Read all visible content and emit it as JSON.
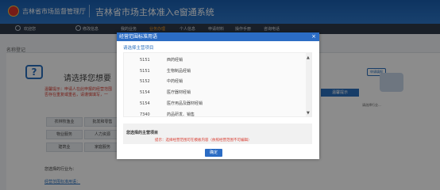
{
  "header": {
    "org": "吉林省市场监督管理厅",
    "system_title": "吉林省市场主体准入e窗通系统"
  },
  "nav": {
    "welcome": "欢迎您",
    "items": [
      {
        "label": "修改信息"
      },
      {
        "label": "我的业务"
      },
      {
        "label": "业务办理"
      },
      {
        "label": "个人信息"
      },
      {
        "label": "申请材料"
      },
      {
        "label": "操作手册"
      },
      {
        "label": "咨询电话"
      }
    ]
  },
  "page": {
    "breadcrumb": "名称登记",
    "prompt": "请选择您想要",
    "warn_line1": "温馨提示：申请人在此申报的经营范围",
    "warn_line2": "否存在重复或重名，请谨慎填写，一",
    "categories": [
      {
        "label": "农林牧渔业"
      },
      {
        "label": "批发和零售"
      },
      {
        "label": "物业服务"
      },
      {
        "label": "人力资源"
      },
      {
        "label": "建筑业"
      },
      {
        "label": "家庭服务"
      }
    ],
    "industry_label": "您选择的行业为：",
    "scope_label": "经营范围标准用语：",
    "side_badge": "申请填报",
    "side_button": "温馨提示",
    "side_text": "请选择行业..."
  },
  "modal": {
    "title": "经营范围标准用语",
    "close": "×",
    "subtitle": "请选择主营项目",
    "rows": [
      {
        "code": "5151",
        "name": "西药经销"
      },
      {
        "code": "5151",
        "name": "生物制品经销"
      },
      {
        "code": "5152",
        "name": "中药经销"
      },
      {
        "code": "5154",
        "name": "医疗器材经销"
      },
      {
        "code": "5154",
        "name": "医疗用品及器材经销"
      },
      {
        "code": "7340",
        "name": "药品研发、销售"
      }
    ],
    "selected_label": "您选择的主营项目",
    "tip": "提示：选择经营范围可在模板内容（依照经营范围不可编辑）",
    "ok_label": "确定"
  }
}
